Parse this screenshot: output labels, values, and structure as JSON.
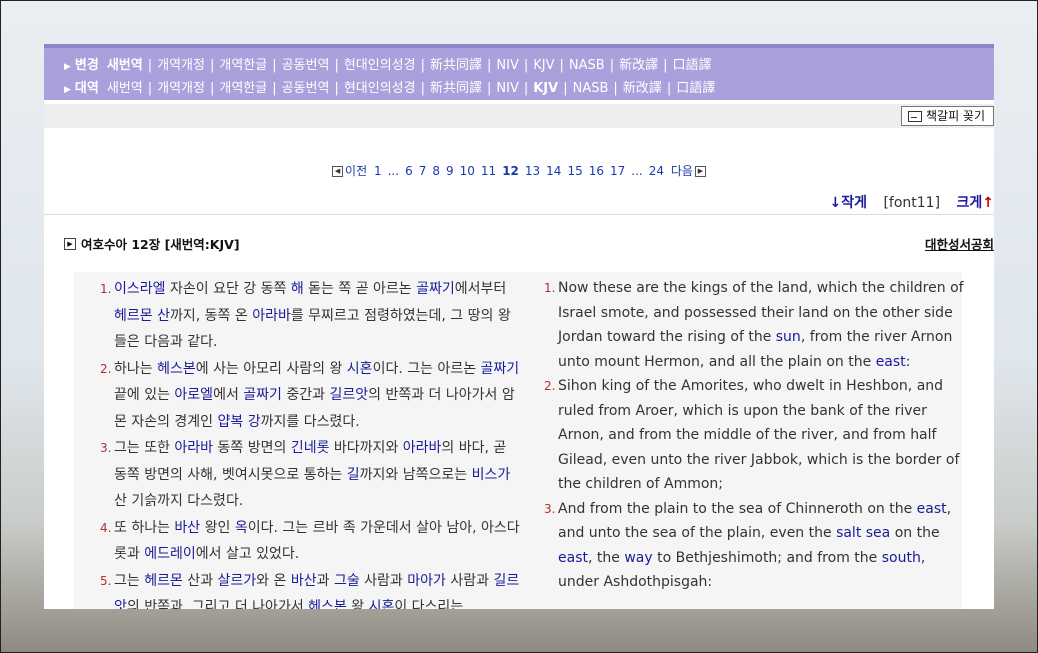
{
  "nav": {
    "row1": {
      "lead": "변경",
      "items": [
        {
          "label": "새번역",
          "active": true
        },
        {
          "label": "개역개정"
        },
        {
          "label": "개역한글"
        },
        {
          "label": "공동번역"
        },
        {
          "label": "현대인의성경"
        },
        {
          "label": "新共同譯"
        },
        {
          "label": "NIV"
        },
        {
          "label": "KJV"
        },
        {
          "label": "NASB"
        },
        {
          "label": "新改譯"
        },
        {
          "label": "口語譯"
        }
      ]
    },
    "row2": {
      "lead": "대역",
      "items": [
        {
          "label": "새번역"
        },
        {
          "label": "개역개정"
        },
        {
          "label": "개역한글"
        },
        {
          "label": "공동번역"
        },
        {
          "label": "현대인의성경"
        },
        {
          "label": "新共同譯"
        },
        {
          "label": "NIV"
        },
        {
          "label": "KJV",
          "active": true
        },
        {
          "label": "NASB"
        },
        {
          "label": "新改譯"
        },
        {
          "label": "口語譯"
        }
      ]
    },
    "separator": "|"
  },
  "toolbar": {
    "bookmark_label": "책갈피 꽂기"
  },
  "pager": {
    "prev_label": "이전",
    "next_label": "다음",
    "pages": [
      "1",
      "...",
      "6",
      "7",
      "8",
      "9",
      "10",
      "11",
      "12",
      "13",
      "14",
      "15",
      "16",
      "17",
      "...",
      "24"
    ],
    "current": "12"
  },
  "font": {
    "smaller": "↓작게",
    "current": "[font11]",
    "bigger_text": "크게",
    "bigger_arrow": "↑"
  },
  "chapter": {
    "title": "여호수아 12장 [새번역:KJV]",
    "publisher": "대한성서공회"
  },
  "korean": [
    {
      "num": "1.",
      "parts": [
        {
          "t": "이스라엘",
          "n": true
        },
        {
          "t": " 자손이 요단 강 동쪽 "
        },
        {
          "t": "해",
          "n": true
        },
        {
          "t": " 돋는 쪽 곧 아르논 "
        },
        {
          "t": "골짜기",
          "n": true
        },
        {
          "t": "에서부터 "
        },
        {
          "t": "헤르몬 산",
          "n": true
        },
        {
          "t": "까지, 동쪽 온 "
        },
        {
          "t": "아라바",
          "n": true
        },
        {
          "t": "를 무찌르고 점령하였는데, 그 땅의 왕들은 다음과 같다."
        }
      ]
    },
    {
      "num": "2.",
      "parts": [
        {
          "t": "하나는 "
        },
        {
          "t": "헤스본",
          "n": true
        },
        {
          "t": "에 사는 아모리 사람의 왕 "
        },
        {
          "t": "시혼",
          "n": true
        },
        {
          "t": "이다. 그는 아르논 "
        },
        {
          "t": "골짜기",
          "n": true
        },
        {
          "t": " 끝에 있는 "
        },
        {
          "t": "아로엘",
          "n": true
        },
        {
          "t": "에서 "
        },
        {
          "t": "골짜기",
          "n": true
        },
        {
          "t": " 중간과 "
        },
        {
          "t": "길르앗",
          "n": true
        },
        {
          "t": "의 반쪽과 더 나아가서 암몬 자손의 경계인 "
        },
        {
          "t": "얍복 강",
          "n": true
        },
        {
          "t": "까지를 다스렸다."
        }
      ]
    },
    {
      "num": "3.",
      "parts": [
        {
          "t": "그는 또한 "
        },
        {
          "t": "아라바",
          "n": true
        },
        {
          "t": " 동쪽 방면의 "
        },
        {
          "t": "긴네롯",
          "n": true
        },
        {
          "t": " 바다까지와 "
        },
        {
          "t": "아라바",
          "n": true
        },
        {
          "t": "의 바다, 곧 동쪽 방면의 사해, 벳여시못으로 통하는 "
        },
        {
          "t": "길",
          "n": true
        },
        {
          "t": "까지와 남쪽으로는 "
        },
        {
          "t": "비스가",
          "n": true
        },
        {
          "t": " 산 기슭까지 다스렸다."
        }
      ]
    },
    {
      "num": "4.",
      "parts": [
        {
          "t": "또 하나는 "
        },
        {
          "t": "바산",
          "n": true
        },
        {
          "t": " 왕인 "
        },
        {
          "t": "옥",
          "n": true
        },
        {
          "t": "이다. 그는 르바 족 가운데서 살아 남아, 아스다롯과 "
        },
        {
          "t": "에드레이",
          "n": true
        },
        {
          "t": "에서 살고 있었다."
        }
      ]
    },
    {
      "num": "5.",
      "parts": [
        {
          "t": "그는 "
        },
        {
          "t": "헤르몬",
          "n": true
        },
        {
          "t": " 산과 "
        },
        {
          "t": "살르가",
          "n": true
        },
        {
          "t": "와 온 "
        },
        {
          "t": "바산",
          "n": true
        },
        {
          "t": "과 "
        },
        {
          "t": "그술",
          "n": true
        },
        {
          "t": " 사람과 "
        },
        {
          "t": "마아가",
          "n": true
        },
        {
          "t": " 사람과 "
        },
        {
          "t": "길르앗",
          "n": true
        },
        {
          "t": "의 반쪽과, 그리고 더 나아가서 "
        },
        {
          "t": "헤스본",
          "n": true
        },
        {
          "t": " 왕 "
        },
        {
          "t": "시혼",
          "n": true
        },
        {
          "t": "이 다스리는"
        }
      ]
    }
  ],
  "english": [
    {
      "num": "1.",
      "parts": [
        {
          "t": "Now these are the kings of the land, which the children of Israel smote, and possessed their land on the other side Jordan toward the rising of the "
        },
        {
          "t": "sun",
          "n": true
        },
        {
          "t": ", from the river Arnon unto mount Hermon, and all the plain on the "
        },
        {
          "t": "east",
          "n": true
        },
        {
          "t": ":"
        }
      ]
    },
    {
      "num": "2.",
      "parts": [
        {
          "t": "Sihon king of the Amorites, who dwelt in Heshbon, and ruled from Aroer, which is upon the bank of the river Arnon, and from the middle of the river, and from half Gilead, even unto the river Jabbok, which is the border of the children of Ammon;"
        }
      ]
    },
    {
      "num": "3.",
      "parts": [
        {
          "t": "And from the plain to the sea of Chinneroth on the "
        },
        {
          "t": "east",
          "n": true
        },
        {
          "t": ", and unto the sea of the plain, even the "
        },
        {
          "t": "salt sea",
          "n": true
        },
        {
          "t": " on the "
        },
        {
          "t": "east",
          "n": true
        },
        {
          "t": ", the "
        },
        {
          "t": "way",
          "n": true
        },
        {
          "t": " to Bethjeshimoth; and from the "
        },
        {
          "t": "south",
          "n": true
        },
        {
          "t": ", under Ashdothpisgah:"
        }
      ]
    }
  ]
}
